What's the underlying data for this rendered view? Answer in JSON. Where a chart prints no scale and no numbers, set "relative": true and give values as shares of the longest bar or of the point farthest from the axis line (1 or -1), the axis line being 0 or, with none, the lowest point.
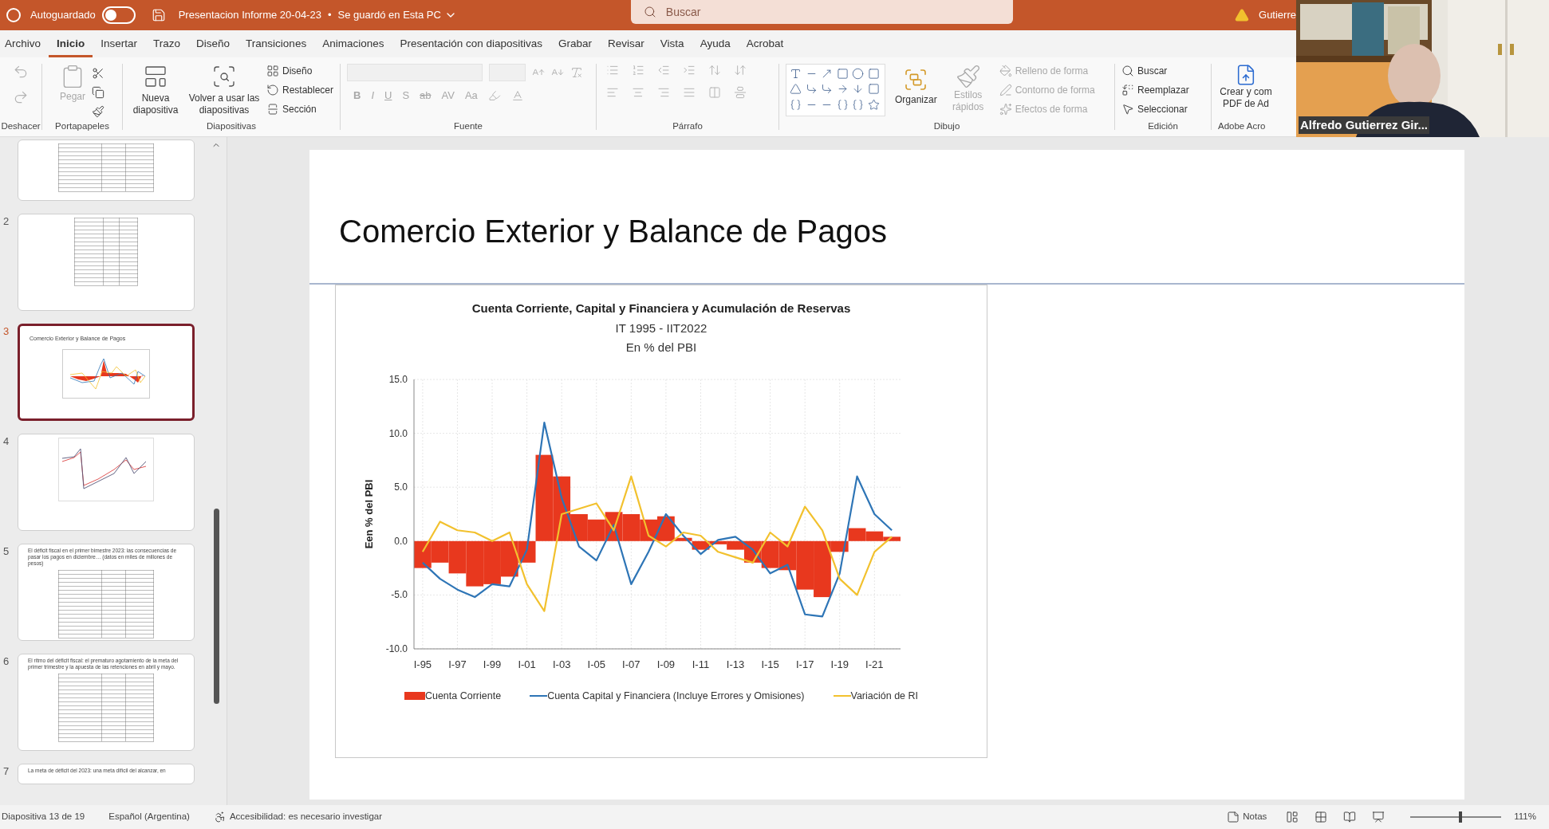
{
  "title_bar": {
    "autosave_label": "Autoguardado",
    "autosave_on": false,
    "file_title": "Presentacion Informe 20-04-23",
    "separator": "•",
    "save_status": "Se guardó en Esta PC",
    "search": {
      "placeholder": "Buscar"
    },
    "user": "Gutierre"
  },
  "tabs": [
    {
      "label": "Archivo",
      "selected": false
    },
    {
      "label": "Inicio",
      "selected": true
    },
    {
      "label": "Insertar",
      "selected": false
    },
    {
      "label": "Trazo",
      "selected": false
    },
    {
      "label": "Diseño",
      "selected": false
    },
    {
      "label": "Transiciones",
      "selected": false
    },
    {
      "label": "Animaciones",
      "selected": false
    },
    {
      "label": "Presentación con diapositivas",
      "selected": false
    },
    {
      "label": "Grabar",
      "selected": false
    },
    {
      "label": "Revisar",
      "selected": false
    },
    {
      "label": "Vista",
      "selected": false
    },
    {
      "label": "Ayuda",
      "selected": false
    },
    {
      "label": "Acrobat",
      "selected": false
    }
  ],
  "ribbon": {
    "undo": {
      "label": "Deshacer"
    },
    "clipboard": {
      "label": "Portapapeles",
      "paste": {
        "label": "Pegar",
        "disabled": true
      }
    },
    "slides": {
      "label": "Diapositivas",
      "new_slide": "Nueva diapositiva",
      "reuse": "Volver a usar las diapositivas",
      "items": [
        "Diseño",
        "Restablecer",
        "Sección"
      ]
    },
    "font": {
      "label": "Fuente",
      "disabled": true,
      "buttons": [
        "B",
        "I",
        "U",
        "S",
        "ab",
        "AV",
        "Aa"
      ]
    },
    "paragraph": {
      "label": "Párrafo",
      "disabled": true
    },
    "drawing": {
      "label": "Dibujo",
      "arrange": "Organizar",
      "quick_styles": {
        "label": "Estilos rápidos",
        "disabled": true
      },
      "shape_options": [
        {
          "label": "Relleno de forma",
          "disabled": true
        },
        {
          "label": "Contorno de forma",
          "disabled": true
        },
        {
          "label": "Efectos de forma",
          "disabled": true
        }
      ]
    },
    "editing": {
      "label": "Edición",
      "items": [
        "Buscar",
        "Reemplazar",
        "Seleccionar"
      ]
    },
    "adobe": {
      "label": "Adobe Acro",
      "button": "Crear y com PDF de Ad"
    }
  },
  "video": {
    "name": "Alfredo Gutierrez Gir..."
  },
  "thumbnails": [
    {
      "kind": "table",
      "selected": false
    },
    {
      "number": "2",
      "kind": "table",
      "selected": false
    },
    {
      "number": "3",
      "kind": "chart",
      "selected": true,
      "title": "Comercio Exterior y Balance de Pagos"
    },
    {
      "number": "4",
      "kind": "line_chart",
      "selected": false
    },
    {
      "number": "5",
      "kind": "table",
      "selected": false,
      "title": "El déficit fiscal en el primer bimestre 2023: las consecuencias de pasar los pagos en diciembre… (datos en miles de millones de pesos)"
    },
    {
      "number": "6",
      "kind": "table",
      "selected": false,
      "title": "El ritmo del déficit fiscal: el prematuro agotamiento de la meta del primer trimestre y la apuesta de las retenciones en abril y mayo."
    },
    {
      "number": "7",
      "kind": "text",
      "selected": false,
      "title": "La meta de déficit del 2023: una meta difícil del alcanzar, en"
    }
  ],
  "slide": {
    "title": "Comercio Exterior y Balance de Pagos",
    "chart": {
      "subtitle": [
        "IT 1995 - IIT2022",
        "En % del PBI"
      ],
      "bars": {
        "chart_data": {
          "type": "bar",
          "title": "Cuenta Corriente, Capital y Financiera y Acumulación de Reservas",
          "ylabel": "Een % del PBI",
          "grid": true,
          "categories": [
            "I-95",
            null,
            "I-97",
            null,
            "I-99",
            null,
            "I-01",
            null,
            "I-03",
            null,
            "I-05",
            null,
            "I-07",
            null,
            "I-09",
            null,
            "I-11",
            null,
            "I-13",
            null,
            "I-15",
            null,
            "I-17",
            null,
            "I-19",
            null,
            "I-21",
            null
          ],
          "series": [
            {
              "name": "Cuenta Corriente",
              "color": "#e8381e",
              "values": [
                -2.5,
                -2,
                -3,
                -4.2,
                -4,
                -3.3,
                -2,
                8,
                6,
                2.5,
                2,
                2.7,
                2.5,
                2,
                2.3,
                0.3,
                -0.8,
                -0.3,
                -0.8,
                -2,
                -2.5,
                -2.7,
                -4.5,
                -5.2,
                -1,
                1.2,
                0.9,
                0.4
              ]
            }
          ],
          "ylim": [
            -10,
            15
          ],
          "yticks": [
            {
              "value": -10,
              "label": "-10.0"
            },
            {
              "value": -5,
              "label": "-5.0"
            },
            {
              "value": 0,
              "label": "0.0"
            },
            {
              "value": 5,
              "label": "5.0"
            },
            {
              "value": 10,
              "label": "10.0"
            },
            {
              "value": 15,
              "label": "15.0"
            }
          ]
        }
      },
      "lines": {
        "chart_data": {
          "type": "line",
          "relative": true,
          "categories": [
            null,
            null,
            null,
            null,
            null,
            null,
            null,
            null,
            null,
            null,
            null,
            null,
            null,
            null,
            null,
            null,
            null,
            null,
            null,
            null,
            null,
            null,
            null,
            null,
            null,
            null,
            null,
            null
          ],
          "series": [
            {
              "name": "Cuenta Capital y Financiera (Incluye Errores y Omisiones)",
              "color": "#2e75b6",
              "values": [
                -2,
                -3.5,
                -4.5,
                -5.2,
                -4,
                -4.2,
                -0.8,
                11,
                4,
                -0.5,
                -1.8,
                1.5,
                -4,
                -1,
                2.5,
                0.5,
                -1.2,
                0.1,
                0.4,
                -0.8,
                -3,
                -2.2,
                -6.8,
                -7,
                -3,
                6,
                2.5,
                1
              ]
            },
            {
              "name": "Variación de RI",
              "color": "#f2c12e",
              "values": [
                -1,
                1.8,
                1,
                0.8,
                0,
                0.8,
                -4,
                -6.5,
                2.5,
                3,
                3.5,
                1,
                6,
                0.5,
                -0.5,
                0.8,
                0.5,
                -1,
                -1.5,
                -2,
                0.8,
                -0.5,
                3.2,
                1,
                -3.5,
                -5,
                -1,
                0.4
              ]
            }
          ],
          "ylim": [
            -10,
            15
          ]
        }
      }
    }
  },
  "status_bar": {
    "slide_info": "Diapositiva 13 de 19",
    "language": "Español (Argentina)",
    "accessibility": "Accesibilidad: es necesario investigar",
    "notes": "Notas",
    "zoom": "111%",
    "zoom_slider": {
      "level": 0.55
    }
  }
}
